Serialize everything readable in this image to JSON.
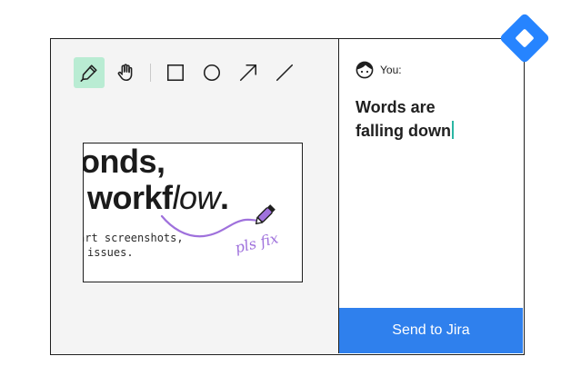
{
  "toolbar": {
    "tools": [
      {
        "name": "pen",
        "active": true
      },
      {
        "name": "hand",
        "active": false
      },
      {
        "name": "rectangle",
        "active": false
      },
      {
        "name": "ellipse",
        "active": false
      },
      {
        "name": "arrow",
        "active": false
      },
      {
        "name": "line",
        "active": false
      }
    ],
    "active_color": "#b9ecd3"
  },
  "document": {
    "line1": "onds,",
    "line2_prefix": "workf",
    "line2_italic": "low",
    "line2_suffix": ".",
    "mono_line1": "art screenshots,",
    "mono_line2": "issues.",
    "annotation_text": "pls fix",
    "annotation_color": "#9f71dc"
  },
  "comment": {
    "author": "You:",
    "text_line1": "Words are",
    "text_line2": "falling down",
    "caret_color": "#2bb6a3"
  },
  "send_button": {
    "label": "Send to Jira",
    "color": "#2f80ed"
  },
  "brand": {
    "logo": "jira-logo-icon",
    "color": "#2684ff"
  }
}
